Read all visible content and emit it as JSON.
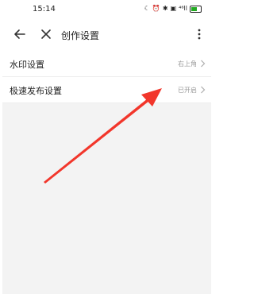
{
  "status_bar": {
    "time": "15:14",
    "icons": [
      "moon-icon",
      "alarm-icon",
      "bluetooth-icon",
      "hd-icon",
      "signal-icon",
      "battery-icon"
    ],
    "signal_text": "⁴⁶ll"
  },
  "header": {
    "title": "创作设置",
    "back_icon": "back-arrow-icon",
    "close_icon": "close-icon",
    "more_icon": "more-vertical-icon"
  },
  "settings": {
    "items": [
      {
        "label": "水印设置",
        "value": "右上角"
      },
      {
        "label": "极速发布设置",
        "value": "已开启"
      }
    ]
  },
  "annotation": {
    "arrow_color": "#f2362b"
  }
}
